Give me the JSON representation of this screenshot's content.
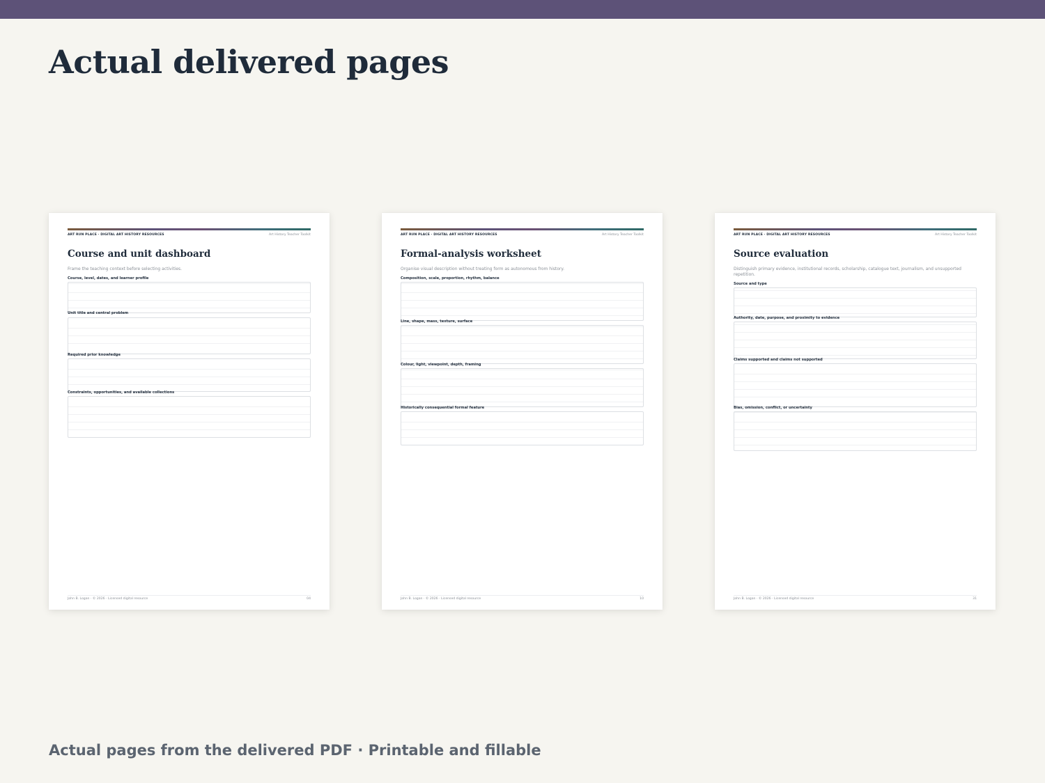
{
  "heading": "Actual delivered pages",
  "caption": "Actual pages from the delivered PDF · Printable and fillable",
  "pages": [
    {
      "brand": "ART RUN PLACE · DIGITAL ART HISTORY RESOURCES",
      "toolkit": "Art History Teacher Toolkit",
      "title": "Course and unit dashboard",
      "description": "Frame the teaching context before selecting activities.",
      "fields": [
        {
          "label": "Course, level, dates, and learner profile"
        },
        {
          "label": "Unit title and central problem"
        },
        {
          "label": "Required prior knowledge"
        },
        {
          "label": "Constraints, opportunities, and available collections"
        }
      ],
      "footer": "John B. Logan · © 2026 · Licensed digital resource",
      "page_number": "04"
    },
    {
      "brand": "ART RUN PLACE · DIGITAL ART HISTORY RESOURCES",
      "toolkit": "Art History Teacher Toolkit",
      "title": "Formal-analysis worksheet",
      "description": "Organise visual description without treating form as autonomous from history.",
      "fields": [
        {
          "label": "Composition, scale, proportion, rhythm, balance"
        },
        {
          "label": "Line, shape, mass, texture, surface"
        },
        {
          "label": "Colour, light, viewpoint, depth, framing"
        },
        {
          "label": "Historically consequential formal feature"
        }
      ],
      "footer": "John B. Logan · © 2026 · Licensed digital resource",
      "page_number": "10"
    },
    {
      "brand": "ART RUN PLACE · DIGITAL ART HISTORY RESOURCES",
      "toolkit": "Art History Teacher Toolkit",
      "title": "Source evaluation",
      "description": "Distinguish primary evidence, institutional records, scholarship, catalogue text, journalism, and unsupported repetition.",
      "fields": [
        {
          "label": "Source and type"
        },
        {
          "label": "Authority, date, purpose, and proximity to evidence"
        },
        {
          "label": "Claims supported and claims not supported"
        },
        {
          "label": "Bias, omission, conflict, or uncertainty"
        }
      ],
      "footer": "John B. Logan · © 2026 · Licensed digital resource",
      "page_number": "31"
    }
  ]
}
